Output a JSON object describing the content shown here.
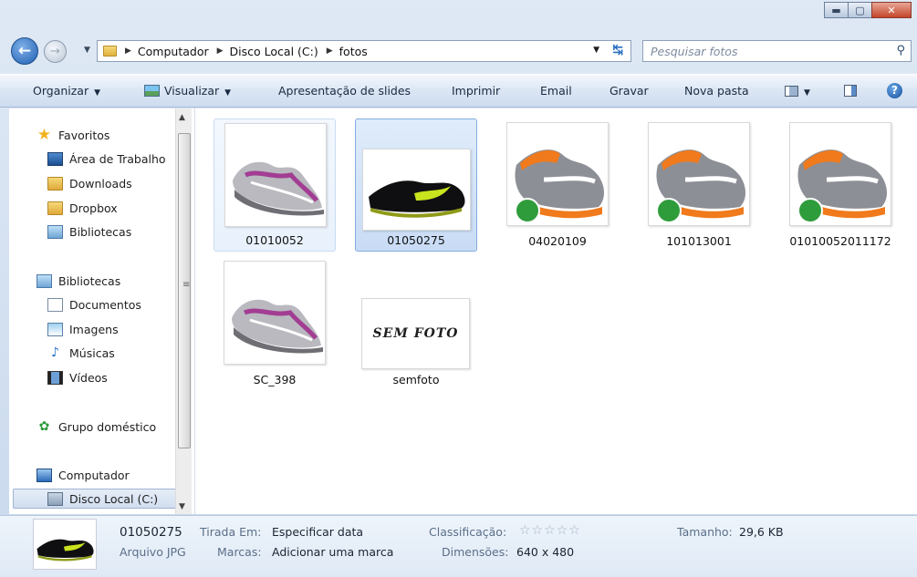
{
  "address": {
    "crumbs": [
      "Computador",
      "Disco Local (C:)",
      "fotos"
    ],
    "search_placeholder": "Pesquisar fotos"
  },
  "commands": {
    "organize": "Organizar",
    "view": "Visualizar",
    "slideshow": "Apresentação de slides",
    "print": "Imprimir",
    "email": "Email",
    "burn": "Gravar",
    "new_folder": "Nova pasta"
  },
  "nav": {
    "favorites": "Favoritos",
    "desktop": "Área de Trabalho",
    "downloads": "Downloads",
    "dropbox": "Dropbox",
    "libraries_fav": "Bibliotecas",
    "libraries": "Bibliotecas",
    "documents": "Documentos",
    "images": "Imagens",
    "music": "Músicas",
    "videos": "Vídeos",
    "homegroup": "Grupo doméstico",
    "computer": "Computador",
    "local_disk": "Disco Local (C:)"
  },
  "files": [
    {
      "name": "01010052",
      "kind": "purple"
    },
    {
      "name": "01050275",
      "kind": "black"
    },
    {
      "name": "04020109",
      "kind": "orange"
    },
    {
      "name": "101013001",
      "kind": "orange"
    },
    {
      "name": "01010052011172",
      "kind": "orange"
    },
    {
      "name": "SC_398",
      "kind": "purple"
    },
    {
      "name": "semfoto",
      "kind": "nofoto",
      "nofoto_text": "SEM FOTO"
    }
  ],
  "details": {
    "name": "01050275",
    "type": "Arquivo JPG",
    "taken_label": "Tirada Em:",
    "taken_value": "Especificar data",
    "tags_label": "Marcas:",
    "tags_value": "Adicionar uma marca",
    "rating_label": "Classificação:",
    "rating_value": 0,
    "dimensions_label": "Dimensões:",
    "dimensions_value": "640 x 480",
    "size_label": "Tamanho:",
    "size_value": "29,6 KB"
  }
}
